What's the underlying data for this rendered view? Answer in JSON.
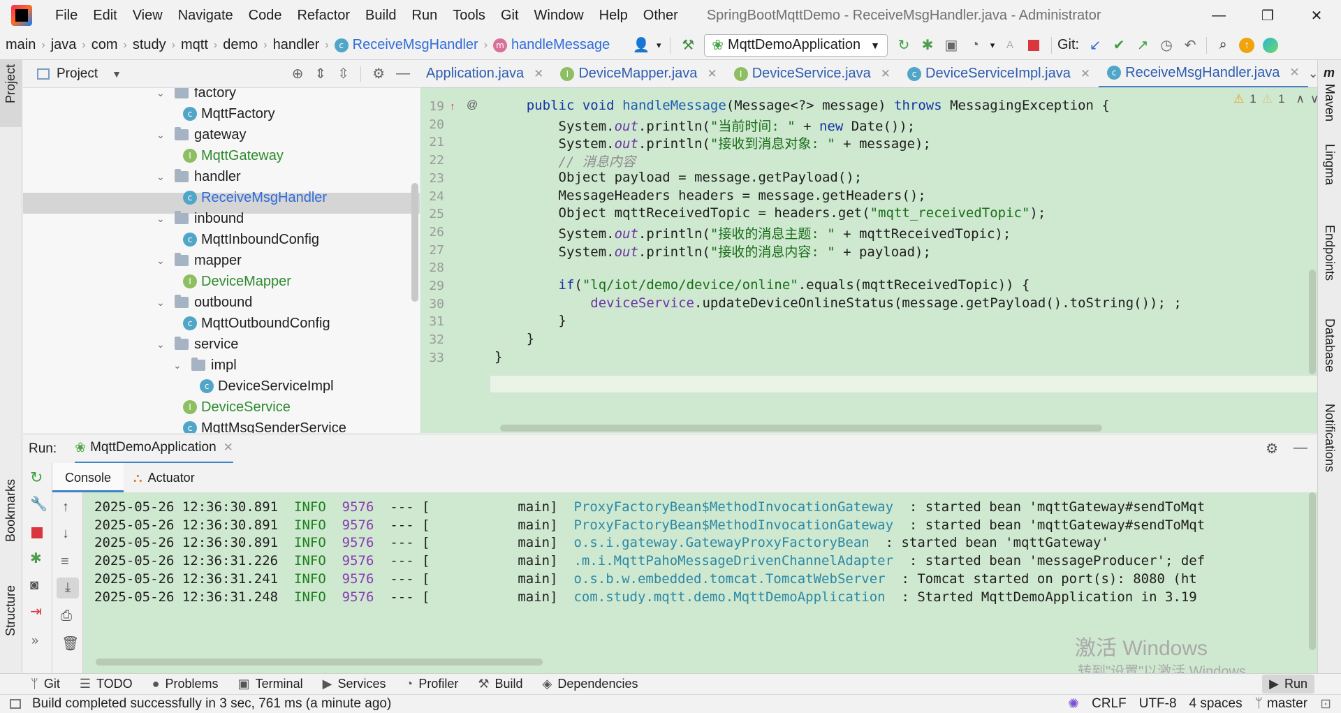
{
  "menubar": {
    "items": [
      "File",
      "Edit",
      "View",
      "Navigate",
      "Code",
      "Refactor",
      "Build",
      "Run",
      "Tools",
      "Git",
      "Window",
      "Help",
      "Other"
    ],
    "title": "SpringBootMqttDemo - ReceiveMsgHandler.java - Administrator"
  },
  "breadcrumb": {
    "items": [
      "main",
      "java",
      "com",
      "study",
      "mqtt",
      "demo",
      "handler"
    ],
    "class_name": "ReceiveMsgHandler",
    "method_name": "handleMessage"
  },
  "toolbar": {
    "run_config": "MqttDemoApplication",
    "git_label": "Git:"
  },
  "left_stripe": {
    "project": "Project",
    "bookmarks": "Bookmarks",
    "structure": "Structure"
  },
  "right_stripe": {
    "maven": "Maven",
    "lingma": "Lingma",
    "endpoints": "Endpoints",
    "database": "Database",
    "notifications": "Notifications"
  },
  "project_panel": {
    "title": "Project",
    "tree": [
      {
        "label": "factory",
        "type": "folder",
        "indent": 0
      },
      {
        "label": "MqttFactory",
        "type": "class",
        "indent": 1
      },
      {
        "label": "gateway",
        "type": "folder",
        "indent": 0
      },
      {
        "label": "MqttGateway",
        "type": "interface",
        "indent": 1
      },
      {
        "label": "handler",
        "type": "folder",
        "indent": 0
      },
      {
        "label": "ReceiveMsgHandler",
        "type": "class-selected",
        "indent": 1
      },
      {
        "label": "inbound",
        "type": "folder",
        "indent": 0
      },
      {
        "label": "MqttInboundConfig",
        "type": "class",
        "indent": 1
      },
      {
        "label": "mapper",
        "type": "folder",
        "indent": 0
      },
      {
        "label": "DeviceMapper",
        "type": "interface",
        "indent": 1
      },
      {
        "label": "outbound",
        "type": "folder",
        "indent": 0
      },
      {
        "label": "MqttOutboundConfig",
        "type": "class",
        "indent": 1
      },
      {
        "label": "service",
        "type": "folder",
        "indent": 0
      },
      {
        "label": "impl",
        "type": "folder",
        "indent": 1
      },
      {
        "label": "DeviceServiceImpl",
        "type": "class",
        "indent": 2
      },
      {
        "label": "DeviceService",
        "type": "interface",
        "indent": 1
      },
      {
        "label": "MqttMsgSenderService",
        "type": "class",
        "indent": 1
      }
    ]
  },
  "editor": {
    "tabs": [
      {
        "label": "Application.java",
        "icon": "none",
        "active": false
      },
      {
        "label": "DeviceMapper.java",
        "icon": "interface",
        "active": false
      },
      {
        "label": "DeviceService.java",
        "icon": "interface",
        "active": false
      },
      {
        "label": "DeviceServiceImpl.java",
        "icon": "class",
        "active": false
      },
      {
        "label": "ReceiveMsgHandler.java",
        "icon": "class",
        "active": true
      }
    ],
    "warnings": "1",
    "weak_warnings": "1",
    "line_numbers": [
      "19",
      "20",
      "21",
      "22",
      "23",
      "24",
      "25",
      "26",
      "27",
      "28",
      "29",
      "30",
      "31",
      "32",
      "33"
    ],
    "lines": [
      "    public void handleMessage(Message<?> message) throws MessagingException {",
      "        System.out.println(\"当前时间: \" + new Date());",
      "        System.out.println(\"接收到消息对象: \" + message);",
      "        // 消息内容",
      "        Object payload = message.getPayload();",
      "        MessageHeaders headers = message.getHeaders();",
      "        Object mqttReceivedTopic = headers.get(\"mqtt_receivedTopic\");",
      "        System.out.println(\"接收的消息主题: \" + mqttReceivedTopic);",
      "        System.out.println(\"接收的消息内容: \" + payload);",
      "",
      "        if(\"lq/iot/demo/device/online\".equals(mqttReceivedTopic)) {",
      "            deviceService.updateDeviceOnlineStatus(message.getPayload().toString()); ;",
      "        }",
      "    }",
      "}"
    ]
  },
  "run_panel": {
    "label": "Run:",
    "app": "MqttDemoApplication",
    "tabs": [
      "Console",
      "Actuator"
    ],
    "log": [
      {
        "ts": "2025-05-26 12:36:30.891",
        "level": "INFO",
        "pid": "9576",
        "sep": "--- [",
        "thread": "main]",
        "logger": "ProxyFactoryBean$MethodInvocationGateway",
        "msg": ": started bean 'mqttGateway#sendToMqt"
      },
      {
        "ts": "2025-05-26 12:36:30.891",
        "level": "INFO",
        "pid": "9576",
        "sep": "--- [",
        "thread": "main]",
        "logger": "ProxyFactoryBean$MethodInvocationGateway",
        "msg": ": started bean 'mqttGateway#sendToMqt"
      },
      {
        "ts": "2025-05-26 12:36:30.891",
        "level": "INFO",
        "pid": "9576",
        "sep": "--- [",
        "thread": "main]",
        "logger": "o.s.i.gateway.GatewayProxyFactoryBean",
        "msg": ": started bean 'mqttGateway'"
      },
      {
        "ts": "2025-05-26 12:36:31.226",
        "level": "INFO",
        "pid": "9576",
        "sep": "--- [",
        "thread": "main]",
        "logger": ".m.i.MqttPahoMessageDrivenChannelAdapter",
        "msg": ": started bean 'messageProducer'; def"
      },
      {
        "ts": "2025-05-26 12:36:31.241",
        "level": "INFO",
        "pid": "9576",
        "sep": "--- [",
        "thread": "main]",
        "logger": "o.s.b.w.embedded.tomcat.TomcatWebServer",
        "msg": ": Tomcat started on port(s): 8080 (ht"
      },
      {
        "ts": "2025-05-26 12:36:31.248",
        "level": "INFO",
        "pid": "9576",
        "sep": "--- [",
        "thread": "main]",
        "logger": "com.study.mqtt.demo.MqttDemoApplication",
        "msg": ": Started MqttDemoApplication in 3.19"
      }
    ],
    "watermark_title": "激活 Windows",
    "watermark_sub": "转到\"设置\"以激活 Windows"
  },
  "bottom_tools": [
    "Git",
    "TODO",
    "Problems",
    "Terminal",
    "Services",
    "Profiler",
    "Build",
    "Dependencies"
  ],
  "run_tool_active": "Run",
  "status": {
    "message": "Build completed successfully in 3 sec, 761 ms (a minute ago)",
    "line_sep": "CRLF",
    "encoding": "UTF-8",
    "indent": "4 spaces",
    "branch": "master"
  }
}
